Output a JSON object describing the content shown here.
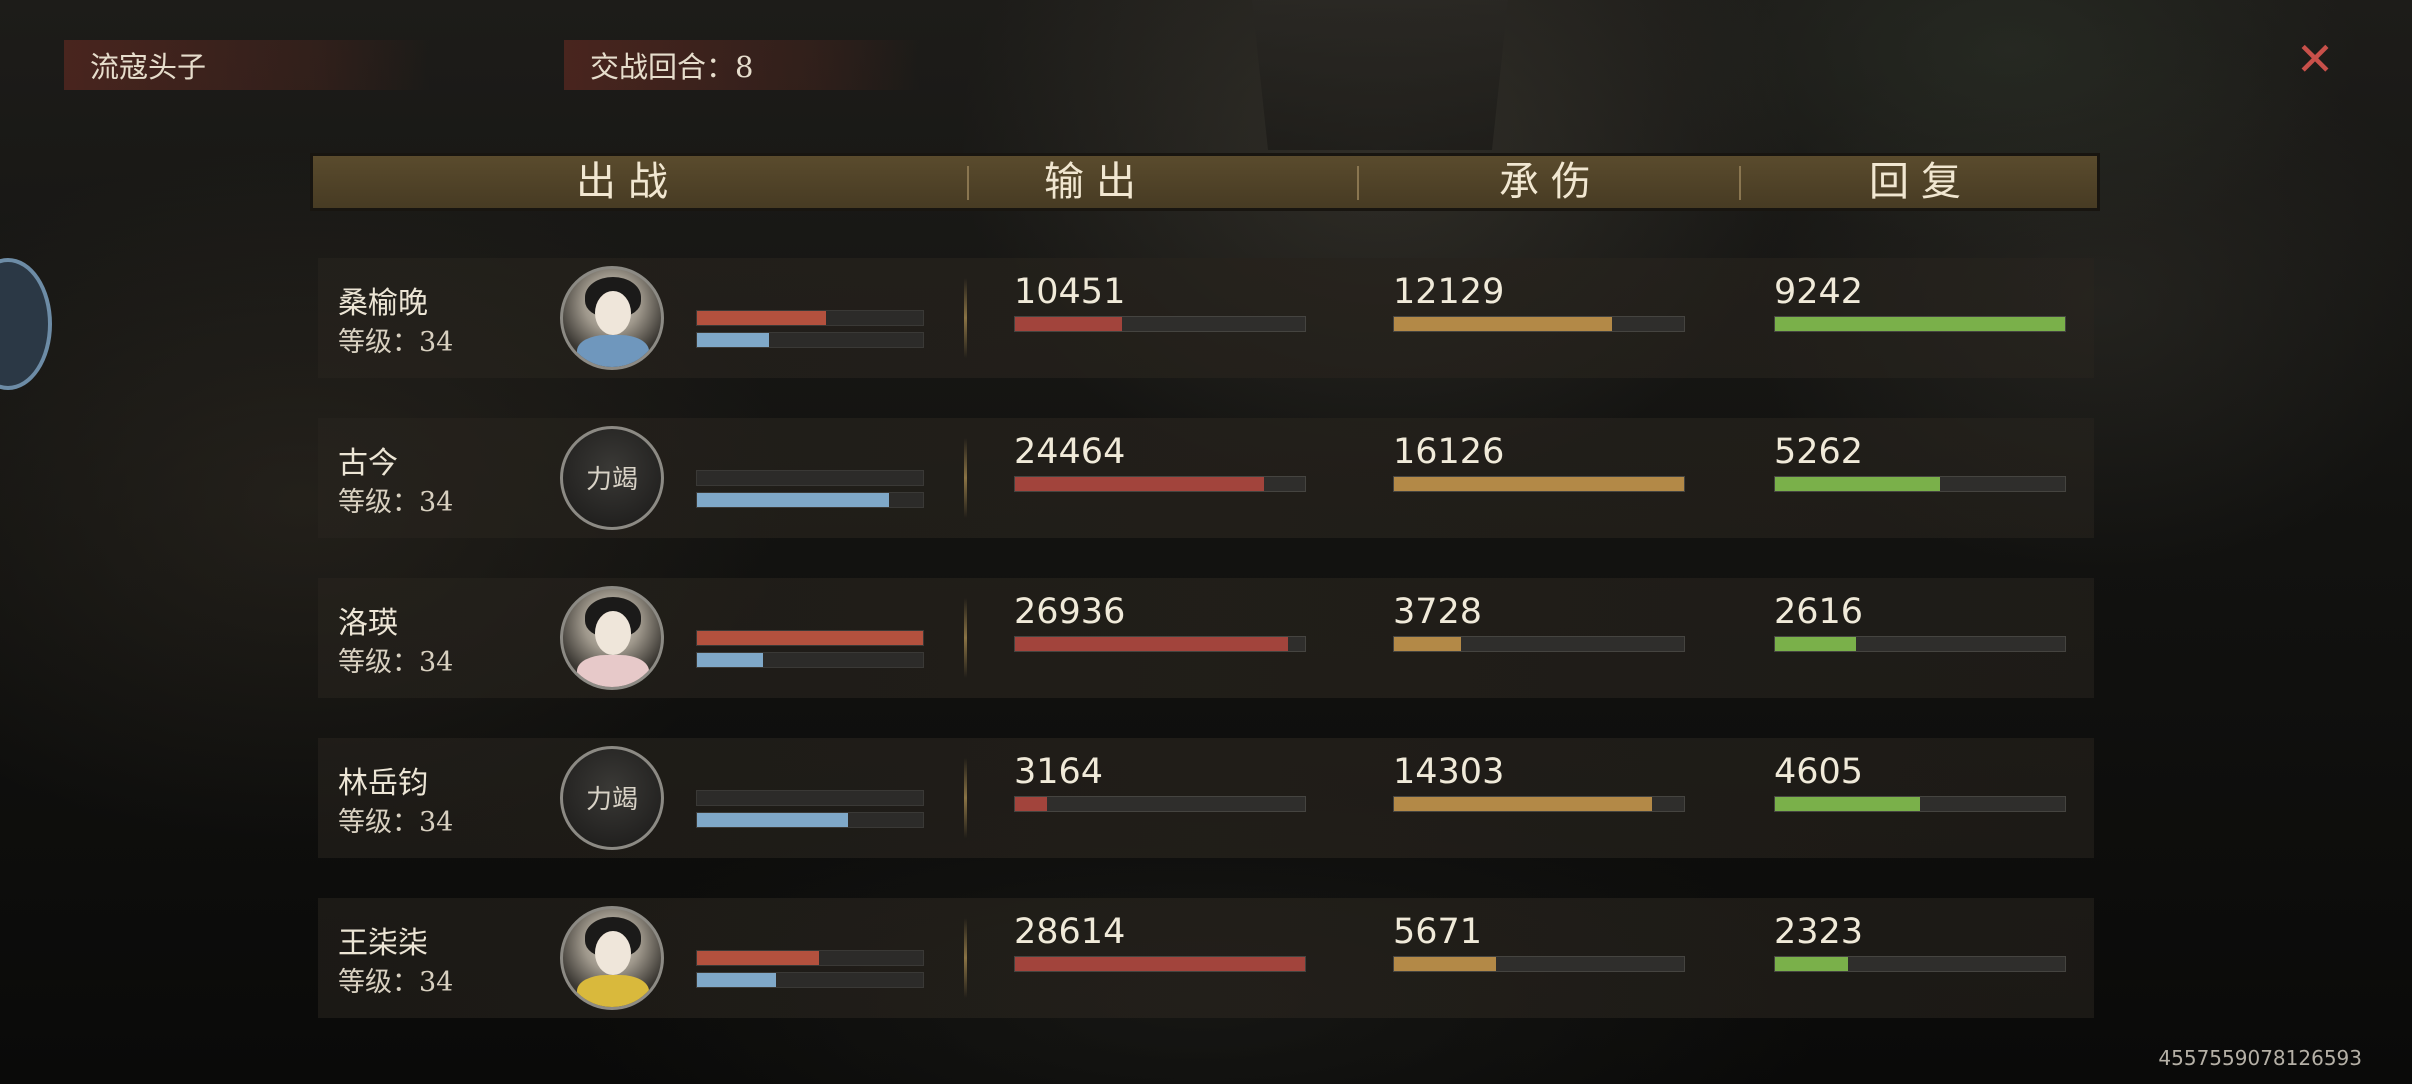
{
  "top": {
    "enemy_name": "流寇头子",
    "round_label": "交战回合：8"
  },
  "header": {
    "col_fighters": "出战",
    "col_output": "输出",
    "col_damage_taken": "承伤",
    "col_healing": "回复"
  },
  "colors": {
    "output_bar": "#a2443c",
    "damage_bar": "#b38947",
    "heal_bar": "#7ab04a",
    "hp_bar": "#b3513e",
    "mp_bar": "#7fa8c8",
    "close": "#c8504a"
  },
  "rows": [
    {
      "name": "桑榆晚",
      "level": "等级：34",
      "avatar": "female-portrait-blue",
      "hp_fill": 0.57,
      "mp_fill": 0.32,
      "output": "10451",
      "output_fill": 0.37,
      "damage": "12129",
      "damage_fill": 0.75,
      "heal": "9242",
      "heal_fill": 1.0
    },
    {
      "name": "古今",
      "level": "等级：34",
      "avatar": "male-portrait-dark",
      "avatar_text": "力竭",
      "hp_fill": 0.0,
      "mp_fill": 0.85,
      "output": "24464",
      "output_fill": 0.86,
      "damage": "16126",
      "damage_fill": 1.0,
      "heal": "5262",
      "heal_fill": 0.57
    },
    {
      "name": "洛瑛",
      "level": "等级：34",
      "avatar": "female-portrait-pink",
      "hp_fill": 1.0,
      "mp_fill": 0.29,
      "output": "26936",
      "output_fill": 0.94,
      "damage": "3728",
      "damage_fill": 0.23,
      "heal": "2616",
      "heal_fill": 0.28
    },
    {
      "name": "林岳钧",
      "level": "等级：34",
      "avatar": "male-portrait-dark",
      "avatar_text": "力竭",
      "hp_fill": 0.0,
      "mp_fill": 0.67,
      "output": "3164",
      "output_fill": 0.11,
      "damage": "14303",
      "damage_fill": 0.89,
      "heal": "4605",
      "heal_fill": 0.5
    },
    {
      "name": "王柒柒",
      "level": "等级：34",
      "avatar": "female-portrait-yellow",
      "hp_fill": 0.54,
      "mp_fill": 0.35,
      "output": "28614",
      "output_fill": 1.0,
      "damage": "5671",
      "damage_fill": 0.35,
      "heal": "2323",
      "heal_fill": 0.25
    }
  ],
  "footer": {
    "uid": "4557559078126593"
  }
}
